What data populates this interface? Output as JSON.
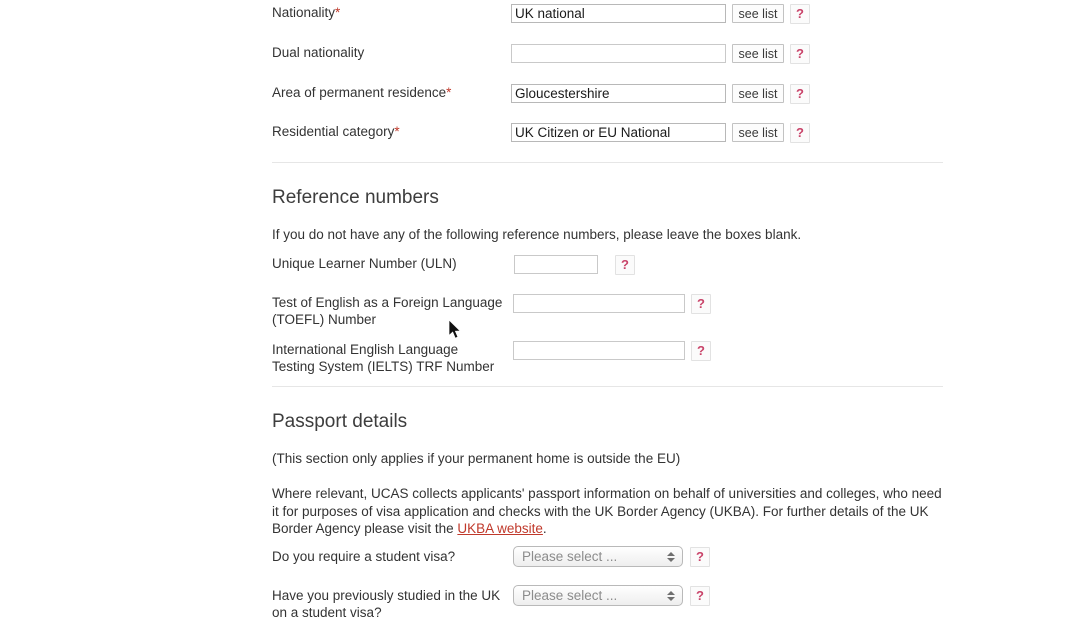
{
  "personal": {
    "fields": [
      {
        "label": "Nationality",
        "required": true,
        "value": "UK national",
        "placeholder": "",
        "see_list_label": "see list",
        "help_label": "?"
      },
      {
        "label": "Dual nationality",
        "required": false,
        "value": "",
        "placeholder": "",
        "see_list_label": "see list",
        "help_label": "?"
      },
      {
        "label": "Area of permanent residence",
        "required": true,
        "value": "Gloucestershire",
        "placeholder": "",
        "see_list_label": "see list",
        "help_label": "?"
      },
      {
        "label": "Residential category",
        "required": true,
        "value": "UK Citizen or EU National",
        "placeholder": "",
        "see_list_label": "see list",
        "help_label": "?"
      }
    ]
  },
  "reference_numbers": {
    "heading": "Reference numbers",
    "intro": "If you do not have any of the following reference numbers, please leave the boxes blank.",
    "fields": [
      {
        "label": "Unique Learner Number (ULN)",
        "value": "",
        "placeholder": "",
        "help_label": "?"
      },
      {
        "label": "Test of English as a Foreign Language\n(TOEFL) Number",
        "value": "",
        "placeholder": "",
        "help_label": "?"
      },
      {
        "label": "International English Language\nTesting System (IELTS) TRF Number",
        "value": "",
        "placeholder": "",
        "help_label": "?"
      }
    ]
  },
  "passport_details": {
    "heading": "Passport details",
    "note": "(This section only applies if your permanent home is outside the EU)",
    "body_part1": "Where relevant, UCAS collects applicants' passport information on behalf of universities and colleges, who need it for purposes of visa application and checks with the UK Border Agency (UKBA). For further details of the UK Border Agency please visit the ",
    "link_text": "UKBA website",
    "body_part2": ".",
    "questions": [
      {
        "label": "Do you require a student visa?",
        "selected": "Please select ...",
        "help_label": "?"
      },
      {
        "label": "Have you previously studied in the UK\non a student visa?",
        "selected": "Please select ...",
        "help_label": "?"
      }
    ]
  },
  "colors": {
    "required_asterisk": "#c0392b",
    "help_glyph": "#c9446a",
    "link": "#c0392b",
    "divider": "#e6e6e6",
    "text": "#333333"
  },
  "icons": {
    "mouse_cursor": "mouse-pointer-icon",
    "select_arrows": "stepper-arrows-icon"
  }
}
